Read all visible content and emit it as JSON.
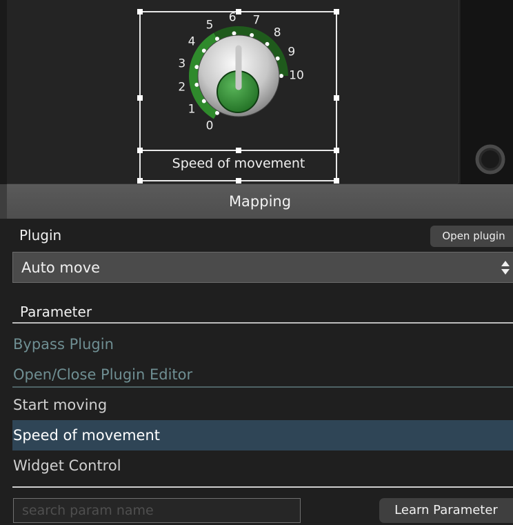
{
  "widget": {
    "label": "Speed of movement",
    "knob_scale": [
      "0",
      "1",
      "2",
      "3",
      "4",
      "5",
      "6",
      "7",
      "8",
      "9",
      "10"
    ],
    "knob_value": 5,
    "accent_color": "#2f8a2c"
  },
  "mapping": {
    "header": "Mapping",
    "plugin_label": "Plugin",
    "open_plugin_label": "Open plugin",
    "plugin_selected": "Auto move",
    "parameter_label": "Parameter",
    "parameters": [
      {
        "label": "Bypass Plugin",
        "state": "disabled"
      },
      {
        "label": "Open/Close Plugin Editor",
        "state": "disabled"
      },
      {
        "label": "Start moving",
        "state": "normal"
      },
      {
        "label": "Speed of movement",
        "state": "selected"
      },
      {
        "label": "Widget Control",
        "state": "normal"
      }
    ],
    "search_placeholder": "search param name",
    "learn_parameter_label": "Learn Parameter"
  },
  "colors": {
    "selected_row": "#2f4556",
    "disabled_text": "#6f8f93"
  }
}
